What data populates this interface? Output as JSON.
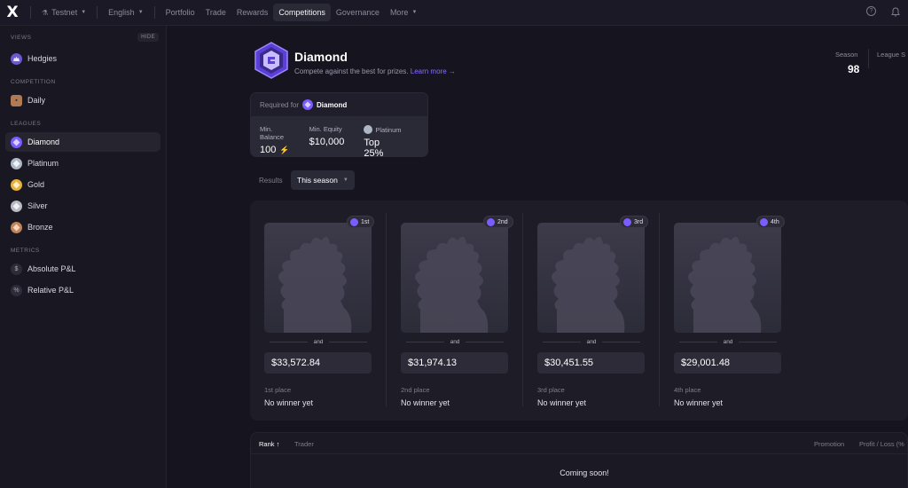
{
  "topbar": {
    "logo": "X",
    "network": "Testnet",
    "language": "English",
    "nav": [
      "Portfolio",
      "Trade",
      "Rewards",
      "Competitions",
      "Governance",
      "More"
    ],
    "active_nav": "Competitions",
    "icons": [
      "help-icon",
      "bell-icon"
    ]
  },
  "sidebar": {
    "views_label": "VIEWS",
    "hide_label": "HIDE",
    "views": [
      {
        "label": "Hedgies",
        "icon": "hedgie-icon"
      }
    ],
    "competition_label": "COMPETITION",
    "competition": [
      {
        "label": "Daily",
        "icon": "bronze-badge-icon"
      }
    ],
    "leagues_label": "LEAGUES",
    "leagues": [
      {
        "label": "Diamond",
        "icon": "diamond-badge-icon",
        "color": "#7b5cff",
        "active": true
      },
      {
        "label": "Platinum",
        "icon": "platinum-badge-icon",
        "color": "#aeb8c4"
      },
      {
        "label": "Gold",
        "icon": "gold-badge-icon",
        "color": "#e6b23c"
      },
      {
        "label": "Silver",
        "icon": "silver-badge-icon",
        "color": "#b9b9c2"
      },
      {
        "label": "Bronze",
        "icon": "bronze-badge-icon",
        "color": "#c0845a"
      }
    ],
    "metrics_label": "METRICS",
    "metrics": [
      {
        "label": "Absolute P&L",
        "glyph": "$"
      },
      {
        "label": "Relative P&L",
        "glyph": "%"
      }
    ]
  },
  "header": {
    "title": "Diamond",
    "subtitle": "Compete against the best for prizes.",
    "learn_more": "Learn more →",
    "season_label": "Season",
    "season_value": "98",
    "league_label": "League S"
  },
  "requirements": {
    "required_for": "Required for",
    "league": "Diamond",
    "items": [
      {
        "label": "Min. Balance",
        "value": "100"
      },
      {
        "label": "Min. Equity",
        "value": "$10,000"
      },
      {
        "label": "Platinum",
        "value": "Top 25%"
      }
    ]
  },
  "results": {
    "label": "Results",
    "selected": "This season"
  },
  "podium": [
    {
      "rank": "1st",
      "and": "and",
      "prize": "$33,572.84",
      "place": "1st place",
      "winner": "No winner yet"
    },
    {
      "rank": "2nd",
      "and": "and",
      "prize": "$31,974.13",
      "place": "2nd place",
      "winner": "No winner yet"
    },
    {
      "rank": "3rd",
      "and": "and",
      "prize": "$30,451.55",
      "place": "3rd place",
      "winner": "No winner yet"
    },
    {
      "rank": "4th",
      "and": "and",
      "prize": "$29,001.48",
      "place": "4th place",
      "winner": "No winner yet"
    }
  ],
  "table": {
    "columns": [
      "Rank ↑",
      "Trader",
      "Promotion",
      "Profit / Loss (%"
    ],
    "empty_message": "Coming soon!"
  },
  "colors": {
    "accent": "#8a6cff",
    "diamond": "#7b5cff",
    "background": "#16151f"
  }
}
